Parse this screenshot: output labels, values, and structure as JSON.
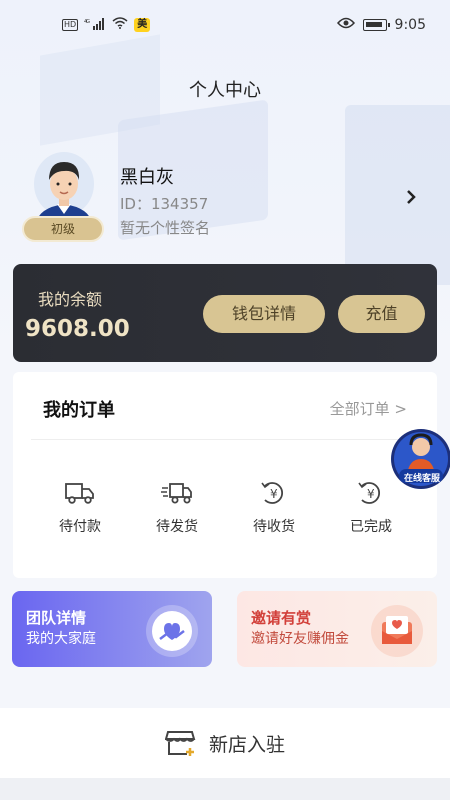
{
  "status_bar": {
    "network": "4G",
    "hd": "HD",
    "app_badge": "美",
    "time": "9:05"
  },
  "page": {
    "title": "个人中心"
  },
  "profile": {
    "name": "黑白灰",
    "id": "ID：134357",
    "signature": "暂无个性签名",
    "level": "初级"
  },
  "balance": {
    "label": "我的余额",
    "value": "9608.00",
    "wallet_button": "钱包详情",
    "recharge_button": "充值"
  },
  "orders": {
    "title": "我的订单",
    "all_link": "全部订单 >",
    "items": [
      {
        "label": "待付款",
        "icon": "truck-outline-icon"
      },
      {
        "label": "待发货",
        "icon": "fast-delivery-icon"
      },
      {
        "label": "待收货",
        "icon": "yen-refresh-icon"
      },
      {
        "label": "已完成",
        "icon": "yen-refresh-icon"
      }
    ]
  },
  "service": {
    "label": "在线客服"
  },
  "cards": {
    "team": {
      "title": "团队详情",
      "subtitle": "我的大家庭"
    },
    "invite": {
      "title": "邀请有赏",
      "subtitle": "邀请好友赚佣金"
    }
  },
  "new_shop": {
    "label": "新店入驻"
  },
  "colors": {
    "gold": "#d8c593",
    "dark_card": "#2b2d33",
    "team_purple": "#6a66f0",
    "invite_red": "#d2403a"
  }
}
